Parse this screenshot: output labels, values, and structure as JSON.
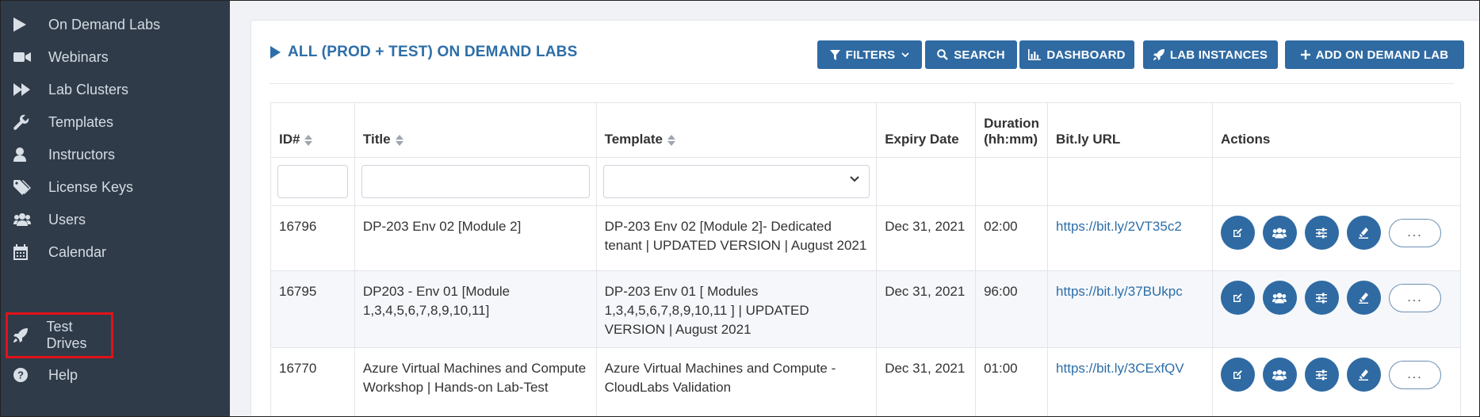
{
  "sidebar": {
    "items": [
      {
        "label": "On Demand Labs",
        "icon": "play-icon"
      },
      {
        "label": "Webinars",
        "icon": "video-camera-icon"
      },
      {
        "label": "Lab Clusters",
        "icon": "fast-forward-icon"
      },
      {
        "label": "Templates",
        "icon": "wrench-icon"
      },
      {
        "label": "Instructors",
        "icon": "user-icon"
      },
      {
        "label": "License Keys",
        "icon": "tag-icon"
      },
      {
        "label": "Users",
        "icon": "users-icon"
      },
      {
        "label": "Calendar",
        "icon": "calendar-icon"
      },
      {
        "label": "Test Drives",
        "icon": "rocket-icon"
      },
      {
        "label": "Help",
        "icon": "question-circle-icon"
      }
    ],
    "highlighted": "Test Drives"
  },
  "page": {
    "title": "ALL (PROD + TEST) ON DEMAND LABS"
  },
  "toolbar": {
    "filters": "FILTERS",
    "search": "SEARCH",
    "dashboard": "DASHBOARD",
    "lab_instances": "LAB INSTANCES",
    "add": "ADD ON DEMAND LAB"
  },
  "table": {
    "headers": {
      "id": "ID#",
      "title": "Title",
      "template": "Template",
      "expiry": "Expiry Date",
      "duration_line1": "Duration",
      "duration_line2": "(hh:mm)",
      "url": "Bit.ly URL",
      "actions": "Actions"
    },
    "rows": [
      {
        "id": "16796",
        "title": "DP-203 Env 02 [Module 2]",
        "template": "DP-203 Env 02 [Module 2]- Dedicated tenant | UPDATED VERSION | August 2021",
        "expiry": "Dec 31, 2021",
        "duration": "02:00",
        "url": "https://bit.ly/2VT35c2"
      },
      {
        "id": "16795",
        "title": "DP203 - Env 01 [Module 1,3,4,5,6,7,8,9,10,11]",
        "template": "DP-203 Env 01 [ Modules 1,3,4,5,6,7,8,9,10,11 ] | UPDATED VERSION | August 2021",
        "expiry": "Dec 31, 2021",
        "duration": "96:00",
        "url": "https://bit.ly/37BUkpc"
      },
      {
        "id": "16770",
        "title": "Azure Virtual Machines and Compute Workshop | Hands-on Lab-Test",
        "template": "Azure Virtual Machines and Compute - CloudLabs Validation",
        "expiry": "Dec 31, 2021",
        "duration": "01:00",
        "url": "https://bit.ly/3CExfQV"
      }
    ],
    "more_label": "..."
  },
  "colors": {
    "sidebar_bg": "#2f3b49",
    "accent": "#2f6aa3",
    "highlight": "#e0121b"
  }
}
